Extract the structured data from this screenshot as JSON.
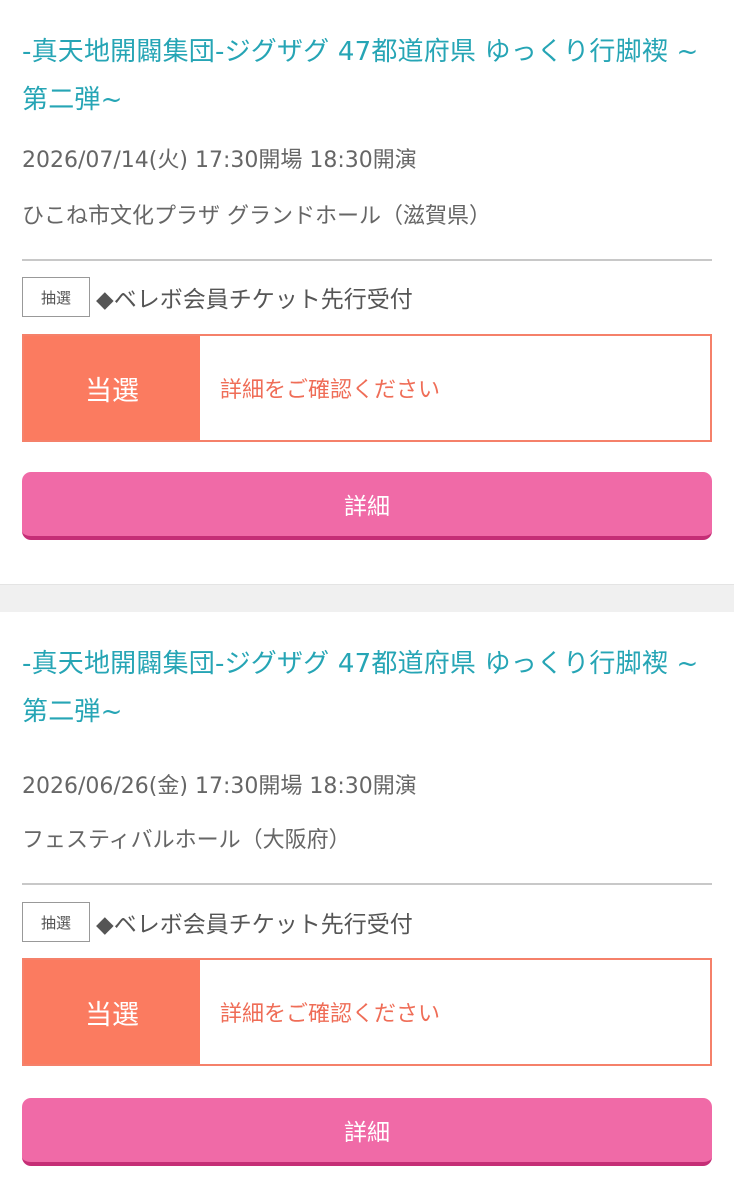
{
  "tickets": [
    {
      "title": "-真天地開闢集団-ジグザグ 47都道府県 ゆっくり行脚禊 ~第二弾~",
      "datetime": "2026/07/14(火) 17:30開場 18:30開演",
      "venue": "ひこね市文化プラザ グランドホール（滋賀県）",
      "type_badge": "抽選",
      "type_label": "◆ベレボ会員チケット先行受付",
      "result_status": "当選",
      "result_message": "詳細をご確認ください",
      "detail_button": "詳細"
    },
    {
      "title": "-真天地開闢集団-ジグザグ 47都道府県 ゆっくり行脚禊 ~第二弾~",
      "datetime": "2026/06/26(金) 17:30開場 18:30開演",
      "venue": "フェスティバルホール（大阪府）",
      "type_badge": "抽選",
      "type_label": "◆ベレボ会員チケット先行受付",
      "result_status": "当選",
      "result_message": "詳細をご確認ください",
      "detail_button": "詳細"
    }
  ],
  "colors": {
    "title": "#26a5b5",
    "result_status_bg": "#fb7b60",
    "result_border": "#f5816a",
    "result_message": "#ef6d57",
    "button_bg": "#f06aa7",
    "button_shadow": "#c52e76"
  }
}
